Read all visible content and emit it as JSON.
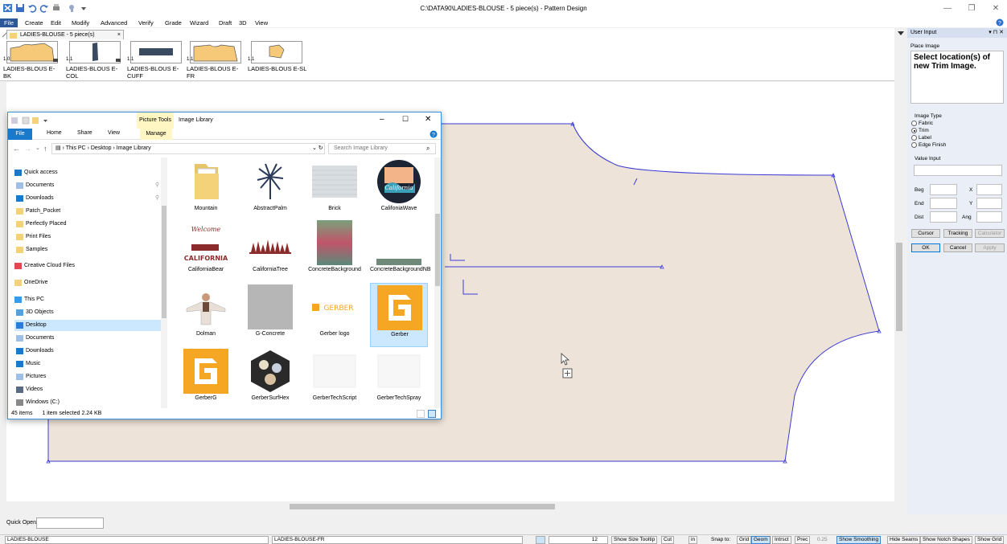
{
  "window": {
    "title": "C:\\DATA90\\LADIES-BLOUSE - 5 piece(s) - Pattern Design"
  },
  "menu": [
    "File",
    "Create",
    "Edit",
    "Modify",
    "Advanced",
    "Verify",
    "Grade",
    "Wizard",
    "Draft",
    "3D",
    "View"
  ],
  "doc_tab": {
    "label": "LADIES-BLOUSE - 5 piece(s)"
  },
  "pieces": [
    {
      "num": "1.0",
      "label": "LADIES-BLOUS E-BK"
    },
    {
      "num": "1.1",
      "label": "LADIES-BLOUS E-COL"
    },
    {
      "num": "1.1",
      "label": "LADIES-BLOUS E-CUFF"
    },
    {
      "num": "1.1",
      "label": "LADIES-BLOUS E-FR"
    },
    {
      "num": "1.1",
      "label": "LADIES-BLOUS E-SL"
    }
  ],
  "user_input": {
    "header": "User Input",
    "place_image": "Place Image",
    "prompt": "Select location(s) of new Trim Image.",
    "image_type_label": "Image Type",
    "image_types": [
      {
        "label": "Fabric",
        "selected": false
      },
      {
        "label": "Trim",
        "selected": true
      },
      {
        "label": "Label",
        "selected": false
      },
      {
        "label": "Edge Finish",
        "selected": false
      }
    ],
    "value_input_label": "Value Input",
    "fields": {
      "beg": "Beg",
      "end": "End",
      "dist": "Dist",
      "x": "X",
      "y": "Y",
      "ang": "Ang"
    },
    "buttons": {
      "cursor": "Cursor",
      "tracking": "Tracking",
      "calculator": "Calculator",
      "ok": "OK",
      "cancel": "Cancel",
      "apply": "Apply"
    }
  },
  "quick_open": {
    "label": "Quick Open"
  },
  "status": {
    "style": "LADIES-BLOUSE",
    "piece": "LADIES-BLOUSE-FR",
    "size": "12",
    "show_size_tooltip": "Show Size Tooltip",
    "cut": "Cut",
    "unit": "in",
    "snap_label": "Snap to:",
    "grid": "Grid",
    "geom": "Geom",
    "intrsct": "Intrsct",
    "prec": "Prec",
    "prec_val": "0.25",
    "show_smoothing": "Show Smoothing",
    "hide_seams": "Hide Seams",
    "show_notch": "Show Notch Shapes",
    "show_grid": "Show Grid"
  },
  "explorer": {
    "title": "Image Library",
    "picture_tools": "Picture Tools",
    "ribbon_tabs": [
      "File",
      "Home",
      "Share",
      "View",
      "Manage"
    ],
    "breadcrumb": [
      "This PC",
      "Desktop",
      "Image Library"
    ],
    "search_placeholder": "Search Image Library",
    "nav": [
      {
        "label": "Quick access",
        "icon": "star-icon",
        "pinned": false
      },
      {
        "label": "Documents",
        "icon": "documents-icon",
        "pinned": true
      },
      {
        "label": "Downloads",
        "icon": "downloads-icon",
        "pinned": true
      },
      {
        "label": "Patch_Pocket",
        "icon": "folder-icon",
        "pinned": false
      },
      {
        "label": "Perfectly Placed",
        "icon": "folder-icon",
        "pinned": false
      },
      {
        "label": "Print Files",
        "icon": "folder-icon",
        "pinned": false
      },
      {
        "label": "Samples",
        "icon": "folder-icon",
        "pinned": false
      },
      {
        "label": "Creative Cloud Files",
        "icon": "creative-cloud-icon",
        "pinned": false
      },
      {
        "label": "OneDrive",
        "icon": "folder-icon",
        "pinned": false
      },
      {
        "label": "This PC",
        "icon": "pc-icon",
        "pinned": false
      },
      {
        "label": "3D Objects",
        "icon": "3d-objects-icon",
        "pinned": false
      },
      {
        "label": "Desktop",
        "icon": "desktop-icon",
        "pinned": false
      },
      {
        "label": "Documents",
        "icon": "documents-icon",
        "pinned": false
      },
      {
        "label": "Downloads",
        "icon": "downloads-icon",
        "pinned": false
      },
      {
        "label": "Music",
        "icon": "music-icon",
        "pinned": false
      },
      {
        "label": "Pictures",
        "icon": "pictures-icon",
        "pinned": false
      },
      {
        "label": "Videos",
        "icon": "videos-icon",
        "pinned": false
      },
      {
        "label": "Windows (C:)",
        "icon": "drive-icon",
        "pinned": false
      }
    ],
    "files": [
      {
        "name": "Mountain",
        "kind": "folder"
      },
      {
        "name": "AbstractPalm",
        "kind": "palm"
      },
      {
        "name": "Brick",
        "kind": "brick"
      },
      {
        "name": "CalifoniaWave",
        "kind": "wave"
      },
      {
        "name": "CaliforniaBear",
        "kind": "bear"
      },
      {
        "name": "CaliforniaTree",
        "kind": "trees"
      },
      {
        "name": "ConcreteBackground",
        "kind": "concrete-color"
      },
      {
        "name": "ConcreteBackgroundNB",
        "kind": "concrete-strip"
      },
      {
        "name": "Dolman",
        "kind": "dolman"
      },
      {
        "name": "G-Concrete",
        "kind": "gray"
      },
      {
        "name": "Gerber logo",
        "kind": "gerber-logo"
      },
      {
        "name": "Gerber",
        "kind": "gerber-g"
      },
      {
        "name": "GerberG",
        "kind": "gerber-g"
      },
      {
        "name": "GerberSurfHex",
        "kind": "hex"
      },
      {
        "name": "GerberTechScript",
        "kind": "blank"
      },
      {
        "name": "GerberTechSpray",
        "kind": "blank"
      }
    ],
    "bear_text": "Welcome to CALIFORNIA",
    "gerber_wordmark": "GERBER",
    "wave_text": "California",
    "status": {
      "count": "45 items",
      "selection": "1 item selected  2.24 KB"
    }
  },
  "colors": {
    "accent": "#2b579a",
    "piece_fill": "#ede3d8",
    "piece_line": "#3b3bd6",
    "gerber": "#f5a623"
  }
}
